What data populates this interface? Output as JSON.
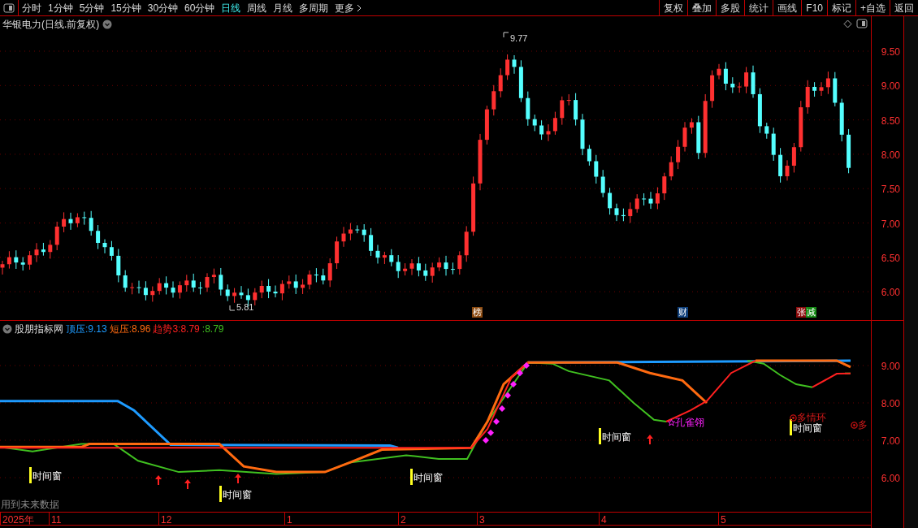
{
  "toolbar": {
    "periods": [
      {
        "label": "分时",
        "selected": false
      },
      {
        "label": "1分钟",
        "selected": false
      },
      {
        "label": "5分钟",
        "selected": false
      },
      {
        "label": "15分钟",
        "selected": false
      },
      {
        "label": "30分钟",
        "selected": false
      },
      {
        "label": "60分钟",
        "selected": false
      },
      {
        "label": "日线",
        "selected": true
      },
      {
        "label": "周线",
        "selected": false
      },
      {
        "label": "月线",
        "selected": false
      },
      {
        "label": "多周期",
        "selected": false
      },
      {
        "label": "更多",
        "selected": false
      }
    ],
    "actions": [
      "复权",
      "叠加",
      "多股",
      "统计",
      "画线",
      "F10",
      "标记",
      "+自选",
      "返回"
    ]
  },
  "chart": {
    "title": "华银电力(日线.前复权)",
    "price_ticks": [
      "9.50",
      "9.00",
      "8.50",
      "8.00",
      "7.50",
      "7.00",
      "6.50",
      "6.00"
    ],
    "high_label": "9.77",
    "low_label": "5.81",
    "events": [
      {
        "label": "榜",
        "color": "#8b4a10"
      },
      {
        "label": "财",
        "color": "#0f3f7a"
      },
      {
        "label": "张",
        "color": "#8a0a0a"
      },
      {
        "label": "减",
        "color": "#138a13"
      }
    ]
  },
  "indicator": {
    "name": "股朋指标网",
    "values": [
      {
        "label": "顶压:",
        "value": "9.13",
        "color": "#1e9bff"
      },
      {
        "label": "短压:",
        "value": "8.96",
        "color": "#ff6a10"
      },
      {
        "label": "趋势3:",
        "value": "8.79",
        "color": "#ff2020"
      },
      {
        "label": ":",
        "value": "8.79",
        "color": "#40c020"
      }
    ],
    "ticks": [
      "9.00",
      "8.00",
      "7.00",
      "6.00"
    ],
    "windows": [
      "时间窗",
      "时间窗",
      "时间窗",
      "时间窗",
      "时间窗"
    ],
    "signals": [
      {
        "kind": "star",
        "text": "孔雀翎"
      },
      {
        "kind": "ring",
        "text": "多情环"
      },
      {
        "kind": "ring",
        "text": "多"
      }
    ],
    "footnote": "用到未来数据"
  },
  "date_axis": [
    "2025年",
    "11",
    "12",
    "1",
    "2",
    "3",
    "4",
    "5"
  ]
}
